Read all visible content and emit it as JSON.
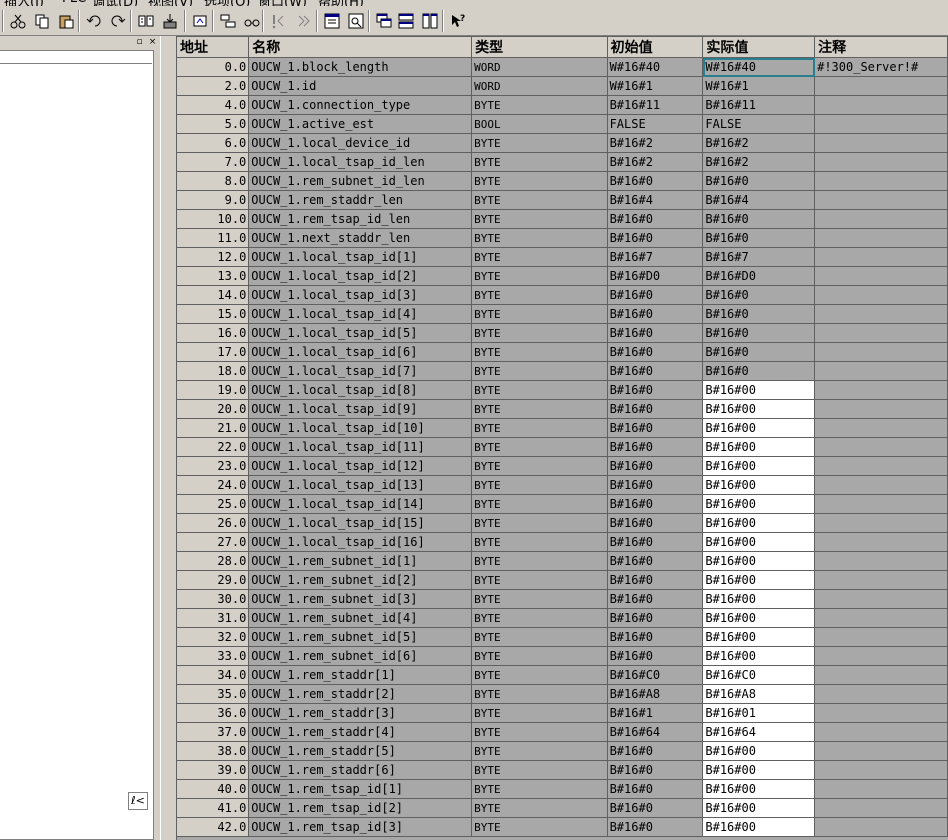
{
  "menu": [
    "插入(I)",
    "PLC",
    "调试(D)",
    "视图(V)",
    "选项(O)",
    "窗口(W)",
    "帮助(H)"
  ],
  "toolbar": {
    "icons": [
      "cut-icon",
      "copy-icon",
      "paste-icon",
      "undo-icon",
      "redo-icon",
      "compare-icon",
      "download-icon",
      "monitor-icon",
      "variable-table-icon",
      "glasses-icon",
      "breakpoint-icon",
      "step-icon",
      "overview-icon",
      "detail-icon",
      "window-stack-icon",
      "window-horizontal-icon",
      "window-vertical-icon",
      "help-arrow-icon"
    ]
  },
  "left": {
    "corner_glyph": "ℓ<"
  },
  "table": {
    "headers": [
      "地址",
      "名称",
      "类型",
      "初始值",
      "实际值",
      "注释"
    ],
    "rows": [
      {
        "addr": "0.0",
        "name": "OUCW_1.block_length",
        "type": "WORD",
        "init": "W#16#40",
        "actual": "W#16#40",
        "comment": "#!300_Server!#"
      },
      {
        "addr": "2.0",
        "name": "OUCW_1.id",
        "type": "WORD",
        "init": "W#16#1",
        "actual": "W#16#1",
        "comment": ""
      },
      {
        "addr": "4.0",
        "name": "OUCW_1.connection_type",
        "type": "BYTE",
        "init": "B#16#11",
        "actual": "B#16#11",
        "comment": ""
      },
      {
        "addr": "5.0",
        "name": "OUCW_1.active_est",
        "type": "BOOL",
        "init": "FALSE",
        "actual": "FALSE",
        "comment": ""
      },
      {
        "addr": "6.0",
        "name": "OUCW_1.local_device_id",
        "type": "BYTE",
        "init": "B#16#2",
        "actual": "B#16#2",
        "comment": ""
      },
      {
        "addr": "7.0",
        "name": "OUCW_1.local_tsap_id_len",
        "type": "BYTE",
        "init": "B#16#2",
        "actual": "B#16#2",
        "comment": ""
      },
      {
        "addr": "8.0",
        "name": "OUCW_1.rem_subnet_id_len",
        "type": "BYTE",
        "init": "B#16#0",
        "actual": "B#16#0",
        "comment": ""
      },
      {
        "addr": "9.0",
        "name": "OUCW_1.rem_staddr_len",
        "type": "BYTE",
        "init": "B#16#4",
        "actual": "B#16#4",
        "comment": ""
      },
      {
        "addr": "10.0",
        "name": "OUCW_1.rem_tsap_id_len",
        "type": "BYTE",
        "init": "B#16#0",
        "actual": "B#16#0",
        "comment": ""
      },
      {
        "addr": "11.0",
        "name": "OUCW_1.next_staddr_len",
        "type": "BYTE",
        "init": "B#16#0",
        "actual": "B#16#0",
        "comment": ""
      },
      {
        "addr": "12.0",
        "name": "OUCW_1.local_tsap_id[1]",
        "type": "BYTE",
        "init": "B#16#7",
        "actual": "B#16#7",
        "comment": ""
      },
      {
        "addr": "13.0",
        "name": "OUCW_1.local_tsap_id[2]",
        "type": "BYTE",
        "init": "B#16#D0",
        "actual": "B#16#D0",
        "comment": ""
      },
      {
        "addr": "14.0",
        "name": "OUCW_1.local_tsap_id[3]",
        "type": "BYTE",
        "init": "B#16#0",
        "actual": "B#16#0",
        "comment": ""
      },
      {
        "addr": "15.0",
        "name": "OUCW_1.local_tsap_id[4]",
        "type": "BYTE",
        "init": "B#16#0",
        "actual": "B#16#0",
        "comment": ""
      },
      {
        "addr": "16.0",
        "name": "OUCW_1.local_tsap_id[5]",
        "type": "BYTE",
        "init": "B#16#0",
        "actual": "B#16#0",
        "comment": ""
      },
      {
        "addr": "17.0",
        "name": "OUCW_1.local_tsap_id[6]",
        "type": "BYTE",
        "init": "B#16#0",
        "actual": "B#16#0",
        "comment": ""
      },
      {
        "addr": "18.0",
        "name": "OUCW_1.local_tsap_id[7]",
        "type": "BYTE",
        "init": "B#16#0",
        "actual": "B#16#0",
        "comment": ""
      },
      {
        "addr": "19.0",
        "name": "OUCW_1.local_tsap_id[8]",
        "type": "BYTE",
        "init": "B#16#0",
        "actual": "B#16#00",
        "comment": ""
      },
      {
        "addr": "20.0",
        "name": "OUCW_1.local_tsap_id[9]",
        "type": "BYTE",
        "init": "B#16#0",
        "actual": "B#16#00",
        "comment": ""
      },
      {
        "addr": "21.0",
        "name": "OUCW_1.local_tsap_id[10]",
        "type": "BYTE",
        "init": "B#16#0",
        "actual": "B#16#00",
        "comment": ""
      },
      {
        "addr": "22.0",
        "name": "OUCW_1.local_tsap_id[11]",
        "type": "BYTE",
        "init": "B#16#0",
        "actual": "B#16#00",
        "comment": ""
      },
      {
        "addr": "23.0",
        "name": "OUCW_1.local_tsap_id[12]",
        "type": "BYTE",
        "init": "B#16#0",
        "actual": "B#16#00",
        "comment": ""
      },
      {
        "addr": "24.0",
        "name": "OUCW_1.local_tsap_id[13]",
        "type": "BYTE",
        "init": "B#16#0",
        "actual": "B#16#00",
        "comment": ""
      },
      {
        "addr": "25.0",
        "name": "OUCW_1.local_tsap_id[14]",
        "type": "BYTE",
        "init": "B#16#0",
        "actual": "B#16#00",
        "comment": ""
      },
      {
        "addr": "26.0",
        "name": "OUCW_1.local_tsap_id[15]",
        "type": "BYTE",
        "init": "B#16#0",
        "actual": "B#16#00",
        "comment": ""
      },
      {
        "addr": "27.0",
        "name": "OUCW_1.local_tsap_id[16]",
        "type": "BYTE",
        "init": "B#16#0",
        "actual": "B#16#00",
        "comment": ""
      },
      {
        "addr": "28.0",
        "name": "OUCW_1.rem_subnet_id[1]",
        "type": "BYTE",
        "init": "B#16#0",
        "actual": "B#16#00",
        "comment": ""
      },
      {
        "addr": "29.0",
        "name": "OUCW_1.rem_subnet_id[2]",
        "type": "BYTE",
        "init": "B#16#0",
        "actual": "B#16#00",
        "comment": ""
      },
      {
        "addr": "30.0",
        "name": "OUCW_1.rem_subnet_id[3]",
        "type": "BYTE",
        "init": "B#16#0",
        "actual": "B#16#00",
        "comment": ""
      },
      {
        "addr": "31.0",
        "name": "OUCW_1.rem_subnet_id[4]",
        "type": "BYTE",
        "init": "B#16#0",
        "actual": "B#16#00",
        "comment": ""
      },
      {
        "addr": "32.0",
        "name": "OUCW_1.rem_subnet_id[5]",
        "type": "BYTE",
        "init": "B#16#0",
        "actual": "B#16#00",
        "comment": ""
      },
      {
        "addr": "33.0",
        "name": "OUCW_1.rem_subnet_id[6]",
        "type": "BYTE",
        "init": "B#16#0",
        "actual": "B#16#00",
        "comment": ""
      },
      {
        "addr": "34.0",
        "name": "OUCW_1.rem_staddr[1]",
        "type": "BYTE",
        "init": "B#16#C0",
        "actual": "B#16#C0",
        "comment": ""
      },
      {
        "addr": "35.0",
        "name": "OUCW_1.rem_staddr[2]",
        "type": "BYTE",
        "init": "B#16#A8",
        "actual": "B#16#A8",
        "comment": ""
      },
      {
        "addr": "36.0",
        "name": "OUCW_1.rem_staddr[3]",
        "type": "BYTE",
        "init": "B#16#1",
        "actual": "B#16#01",
        "comment": ""
      },
      {
        "addr": "37.0",
        "name": "OUCW_1.rem_staddr[4]",
        "type": "BYTE",
        "init": "B#16#64",
        "actual": "B#16#64",
        "comment": ""
      },
      {
        "addr": "38.0",
        "name": "OUCW_1.rem_staddr[5]",
        "type": "BYTE",
        "init": "B#16#0",
        "actual": "B#16#00",
        "comment": ""
      },
      {
        "addr": "39.0",
        "name": "OUCW_1.rem_staddr[6]",
        "type": "BYTE",
        "init": "B#16#0",
        "actual": "B#16#00",
        "comment": ""
      },
      {
        "addr": "40.0",
        "name": "OUCW_1.rem_tsap_id[1]",
        "type": "BYTE",
        "init": "B#16#0",
        "actual": "B#16#00",
        "comment": ""
      },
      {
        "addr": "41.0",
        "name": "OUCW_1.rem_tsap_id[2]",
        "type": "BYTE",
        "init": "B#16#0",
        "actual": "B#16#00",
        "comment": ""
      },
      {
        "addr": "42.0",
        "name": "OUCW_1.rem_tsap_id[3]",
        "type": "BYTE",
        "init": "B#16#0",
        "actual": "B#16#00",
        "comment": ""
      }
    ]
  }
}
